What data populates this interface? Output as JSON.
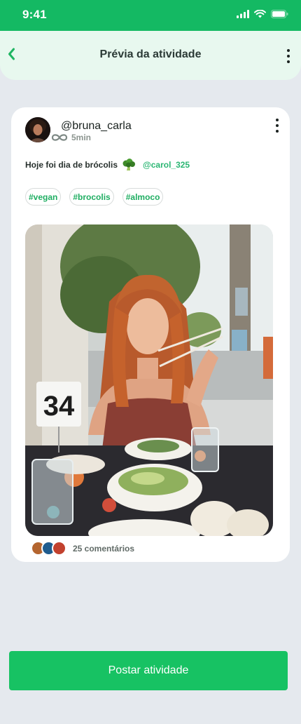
{
  "status": {
    "time": "9:41"
  },
  "header": {
    "title": "Prévia da atividade"
  },
  "post": {
    "username": "@bruna_carla",
    "time_ago": "5min",
    "caption": "Hoje foi dia de brócolis",
    "mention": "@carol_325",
    "tags": [
      "#vegan",
      "#brocolis",
      "#almoco"
    ],
    "photo": {
      "table_number": "34"
    },
    "comments_label": "25 comentários"
  },
  "footer": {
    "post_button": "Postar atividade"
  },
  "colors": {
    "accent": "#17c263",
    "statusbar": "#14b963",
    "tag_text": "#1fae62",
    "mention": "#2bb673"
  },
  "icons": [
    "back-chevron-icon",
    "more-vertical-icon",
    "signal-icon",
    "wifi-icon",
    "battery-icon",
    "infinity-icon",
    "broccoli-icon"
  ]
}
